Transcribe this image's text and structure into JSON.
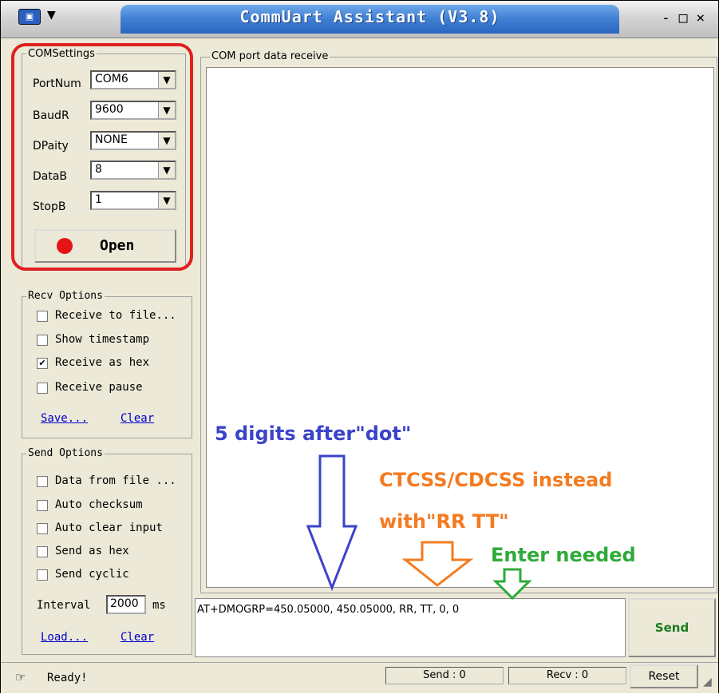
{
  "window": {
    "title": "CommUart Assistant (V3.8)",
    "controls": "- □ ×"
  },
  "com_settings": {
    "group_label": "COMSettings",
    "fields": [
      {
        "label": "PortNum",
        "value": "COM6"
      },
      {
        "label": "BaudR",
        "value": "9600"
      },
      {
        "label": "DPaity",
        "value": "NONE"
      },
      {
        "label": "DataB",
        "value": "8"
      },
      {
        "label": "StopB",
        "value": "1"
      }
    ],
    "open_label": "Open"
  },
  "recv_options": {
    "group_label": "Recv Options",
    "items": [
      {
        "label": "Receive to file...",
        "checked": false
      },
      {
        "label": "Show timestamp",
        "checked": false
      },
      {
        "label": "Receive as hex",
        "checked": true
      },
      {
        "label": "Receive pause",
        "checked": false
      }
    ],
    "save_link": "Save...",
    "clear_link": "Clear"
  },
  "send_options": {
    "group_label": "Send Options",
    "items": [
      {
        "label": "Data from file ...",
        "checked": false
      },
      {
        "label": "Auto checksum",
        "checked": false
      },
      {
        "label": "Auto clear input",
        "checked": false
      },
      {
        "label": "Send as hex",
        "checked": false
      },
      {
        "label": "Send cyclic",
        "checked": false
      }
    ],
    "interval_label": "Interval",
    "interval_value": "2000",
    "interval_unit": "ms",
    "load_link": "Load...",
    "clear_link": "Clear"
  },
  "receive_panel": {
    "group_label": "COM port data receive"
  },
  "send_panel": {
    "input_value": "AT+DMOGRP=450.05000, 450.05000, RR, TT, 0, 0",
    "send_label": "Send"
  },
  "status_bar": {
    "ready_text": "Ready!",
    "send_count": "Send : 0",
    "recv_count": "Recv : 0",
    "reset_label": "Reset"
  },
  "annotations": {
    "digits_note": "5 digits after\"dot\"",
    "ctcss_note_line1": "CTCSS/CDCSS instead",
    "ctcss_note_line2": "with\"RR TT\"",
    "enter_note": "Enter needed"
  },
  "colors": {
    "highlight_frame": "#e02020",
    "annotation_blue": "#3b43c9",
    "annotation_orange": "#f47b20",
    "annotation_green": "#2faa3a",
    "title_bar": "#3f7fd3"
  }
}
